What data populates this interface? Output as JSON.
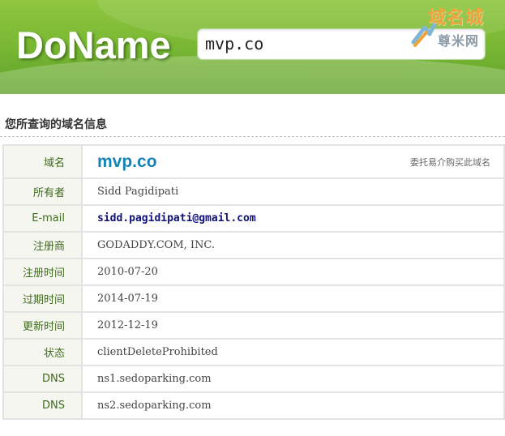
{
  "header": {
    "logo": "DoName",
    "search_value": "mvp.co",
    "watermark_top": "域名城",
    "watermark_bottom": "尊米网"
  },
  "section_title": "您所查询的域名信息",
  "broker_link": "委托易介购买此域名",
  "rows": [
    {
      "label": "域名",
      "value": "mvp.co"
    },
    {
      "label": "所有者",
      "value": "Sidd Pagidipati"
    },
    {
      "label": "E-mail",
      "value": "sidd.pagidipati@gmail.com"
    },
    {
      "label": "注册商",
      "value": "GODADDY.COM, INC."
    },
    {
      "label": "注册时间",
      "value": "2010-07-20"
    },
    {
      "label": "过期时间",
      "value": "2014-07-19"
    },
    {
      "label": "更新时间",
      "value": "2012-12-19"
    },
    {
      "label": "状态",
      "value": "clientDeleteProhibited"
    },
    {
      "label": "DNS",
      "value": "ns1.sedoparking.com"
    },
    {
      "label": "DNS",
      "value": "ns2.sedoparking.com"
    }
  ],
  "colors": {
    "header_green": "#7bb934",
    "label_green": "#3f6b1c",
    "domain_blue": "#1683b6",
    "email_navy": "#10107a"
  }
}
